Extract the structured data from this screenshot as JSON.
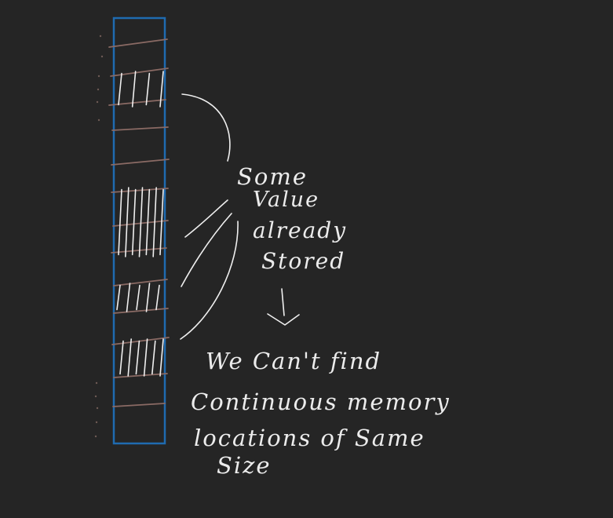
{
  "colors": {
    "background": "#252525",
    "memory_outline": "#1f6bb0",
    "separator": "#8a6a64",
    "ink": "#efefef"
  },
  "annotation": {
    "lines": [
      "Some",
      "Value",
      "already",
      "Stored"
    ]
  },
  "conclusion": {
    "lines": [
      "We Can't find",
      "Continuous memory",
      "locations of Same",
      "Size"
    ]
  },
  "memory": {
    "occupied_blocks": [
      {
        "hatch_count": 4
      },
      {
        "hatch_count": 7
      },
      {
        "hatch_count": 5
      },
      {
        "hatch_count": 6
      }
    ]
  }
}
